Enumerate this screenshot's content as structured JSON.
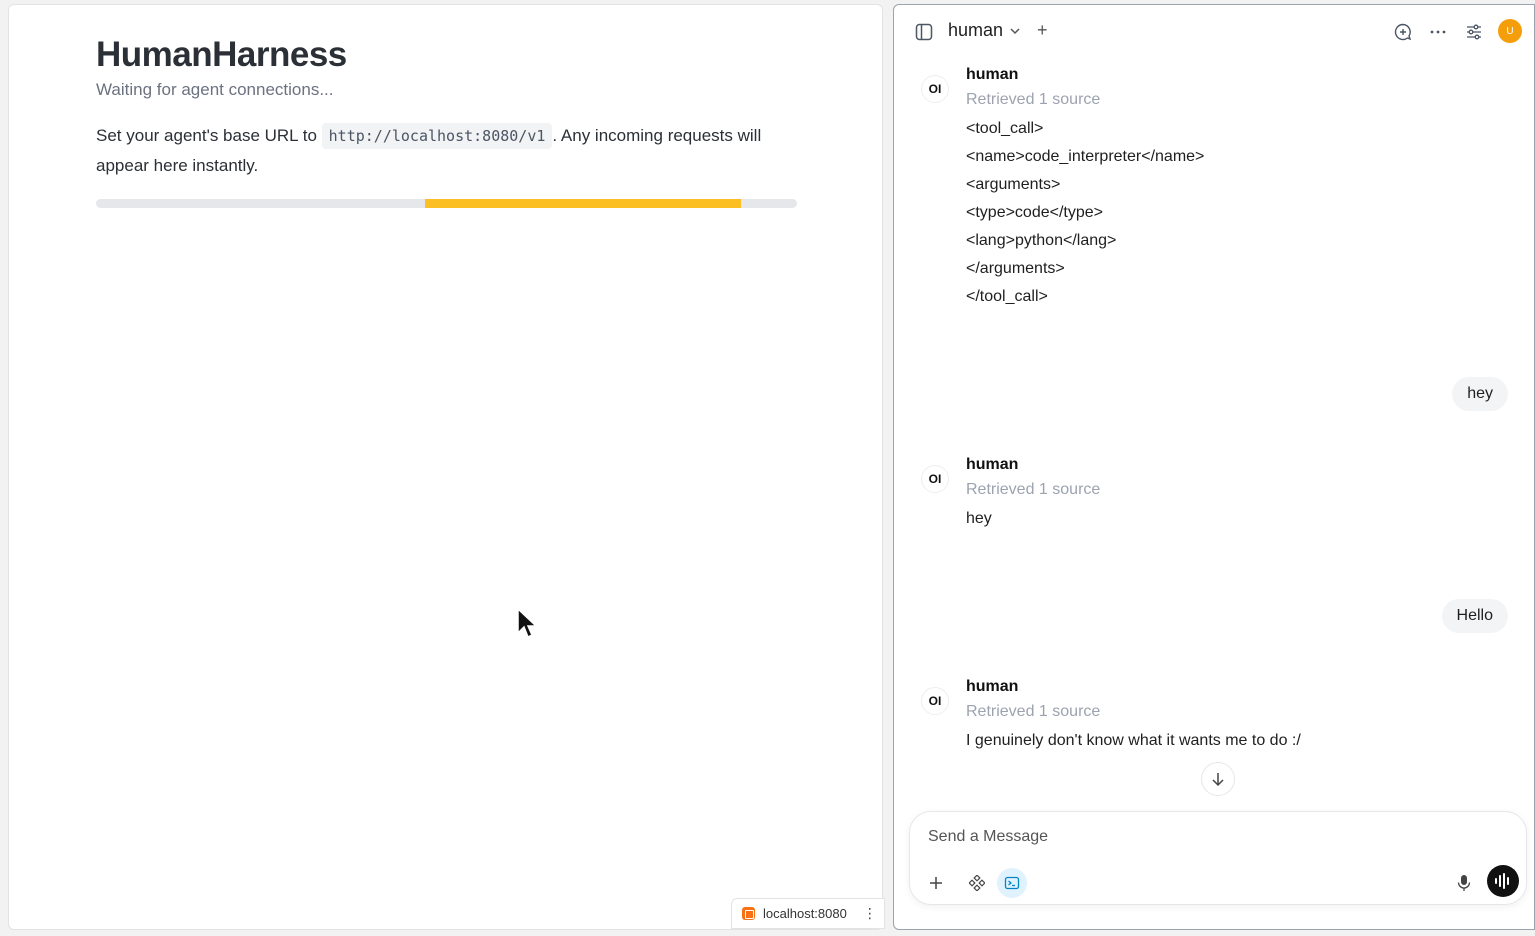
{
  "harness": {
    "title": "HumanHarness",
    "subtitle": "Waiting for agent connections...",
    "desc_prefix": "Set your agent's base URL to",
    "base_url": "http://localhost:8080/v1",
    "desc_suffix": ". Any incoming requests will appear here instantly.",
    "progress_segment_start": 0.47,
    "progress_segment_end": 0.92,
    "progress_color": "#fbbf24"
  },
  "tunnel": {
    "host": "localhost:8080",
    "menu": "⋮"
  },
  "chat": {
    "model": "human",
    "new_chat": "+",
    "avatar_letter": "U",
    "messages": [
      {
        "role": "assistant",
        "badge": "OI",
        "name": "human",
        "source": "Retrieved 1 source",
        "lines": [
          "<tool_call>",
          "<name>code_interpreter</name>",
          "<arguments>",
          "<type>code</type>",
          "<lang>python</lang>",
          "</arguments>",
          "</tool_call>"
        ]
      },
      {
        "role": "user",
        "text": "hey"
      },
      {
        "role": "assistant",
        "badge": "OI",
        "name": "human",
        "source": "Retrieved 1 source",
        "lines": [
          "hey"
        ]
      },
      {
        "role": "user",
        "text": "Hello"
      },
      {
        "role": "assistant",
        "badge": "OI",
        "name": "human",
        "source": "Retrieved 1 source",
        "lines": [
          "I genuinely don't know what it wants me to do :/"
        ]
      }
    ],
    "composer": {
      "placeholder": "Send a Message"
    }
  },
  "colors": {
    "accent": "#f59e0b",
    "code_interpreter_active": "#0284c7"
  }
}
